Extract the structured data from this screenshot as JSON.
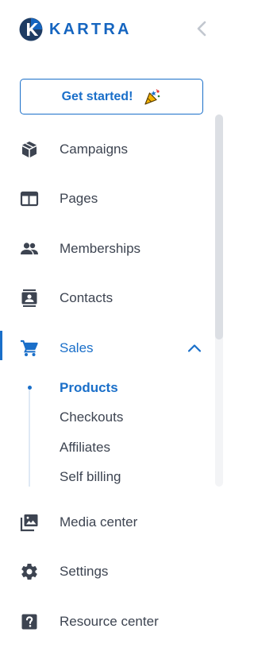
{
  "brand": {
    "name": "KARTRA",
    "color": "#1565c0"
  },
  "accent_color": "#1a6fc9",
  "get_started": {
    "label": "Get started!",
    "icon": "party-popper-icon"
  },
  "nav": {
    "campaigns": {
      "label": "Campaigns",
      "icon": "cube-icon"
    },
    "pages": {
      "label": "Pages",
      "icon": "browser-window-icon"
    },
    "memberships": {
      "label": "Memberships",
      "icon": "people-icon"
    },
    "contacts": {
      "label": "Contacts",
      "icon": "contact-card-icon"
    },
    "sales": {
      "label": "Sales",
      "icon": "shopping-cart-icon",
      "active": true,
      "expanded": true,
      "children": [
        {
          "label": "Products",
          "current": true
        },
        {
          "label": "Checkouts"
        },
        {
          "label": "Affiliates"
        },
        {
          "label": "Self billing"
        }
      ]
    },
    "media_center": {
      "label": "Media center",
      "icon": "photo-library-icon"
    },
    "settings": {
      "label": "Settings",
      "icon": "gear-icon"
    },
    "resource_center": {
      "label": "Resource center",
      "icon": "question-box-icon"
    }
  }
}
